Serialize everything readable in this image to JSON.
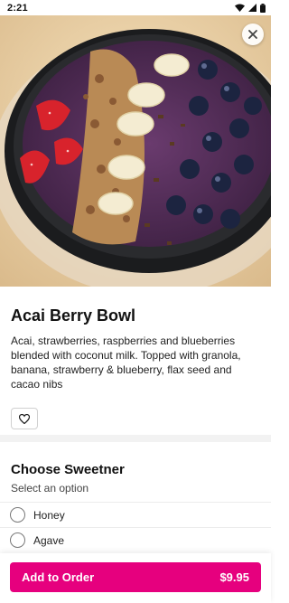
{
  "status_bar": {
    "time": "2:21"
  },
  "item": {
    "title": "Acai Berry Bowl",
    "description": "Acai, strawberries, raspberries and blueberries blended with coconut milk. Topped with granola, banana, strawberry & blueberry, flax seed and cacao nibs"
  },
  "options_section": {
    "title": "Choose Sweetner",
    "subtitle": "Select an option",
    "options": [
      {
        "label": "Honey"
      },
      {
        "label": "Agave"
      }
    ]
  },
  "cart": {
    "add_label": "Add to Order",
    "price": "$9.95"
  },
  "colors": {
    "accent": "#e6007e",
    "divider": "#f2f2f2"
  },
  "icons": [
    "signal-icon",
    "wifi-icon",
    "battery-icon",
    "close-icon",
    "heart-icon"
  ]
}
